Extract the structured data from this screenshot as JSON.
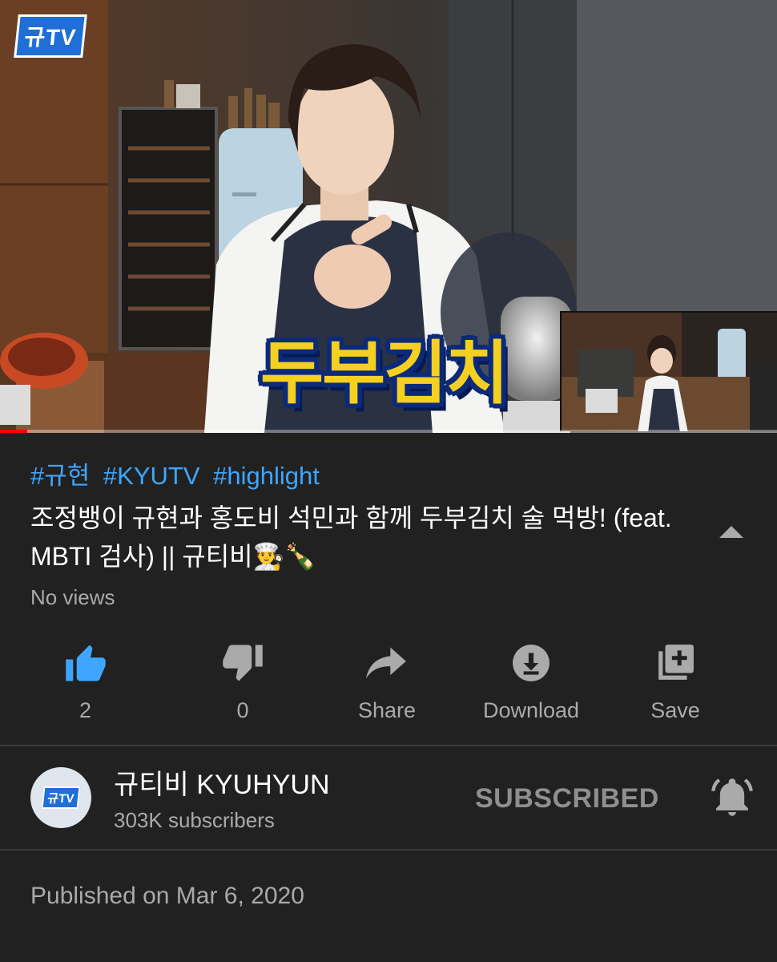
{
  "video": {
    "channel_logo": "규TV",
    "caption": "두부김치",
    "progress": 0.035,
    "accent": "#ff0000"
  },
  "info": {
    "hashtags": [
      "#규현",
      "#KYUTV",
      "#highlight"
    ],
    "title": "조정뱅이 규현과 홍도비 석민과 함께 두부김치 술 먹방! (feat. MBTI 검사) || 규티비👨‍🍳🍾",
    "views": "No views",
    "collapse_icon": "chevron-up-icon",
    "hashtag_color": "#3ea6ff"
  },
  "actions": [
    {
      "id": "like",
      "icon": "thumbs-up-icon",
      "label": "2",
      "active": true,
      "color": "#3ea6ff"
    },
    {
      "id": "dislike",
      "icon": "thumbs-down-icon",
      "label": "0"
    },
    {
      "id": "share",
      "icon": "share-icon",
      "label": "Share"
    },
    {
      "id": "download",
      "icon": "download-icon",
      "label": "Download"
    },
    {
      "id": "save",
      "icon": "add-to-playlist-icon",
      "label": "Save"
    }
  ],
  "channel": {
    "avatar_text": "규TV",
    "name": "규티비 KYUHYUN",
    "subscribers": "303K subscribers",
    "subscribe_state": "SUBSCRIBED",
    "bell_icon": "bell-icon"
  },
  "published": "Published on Mar 6, 2020"
}
